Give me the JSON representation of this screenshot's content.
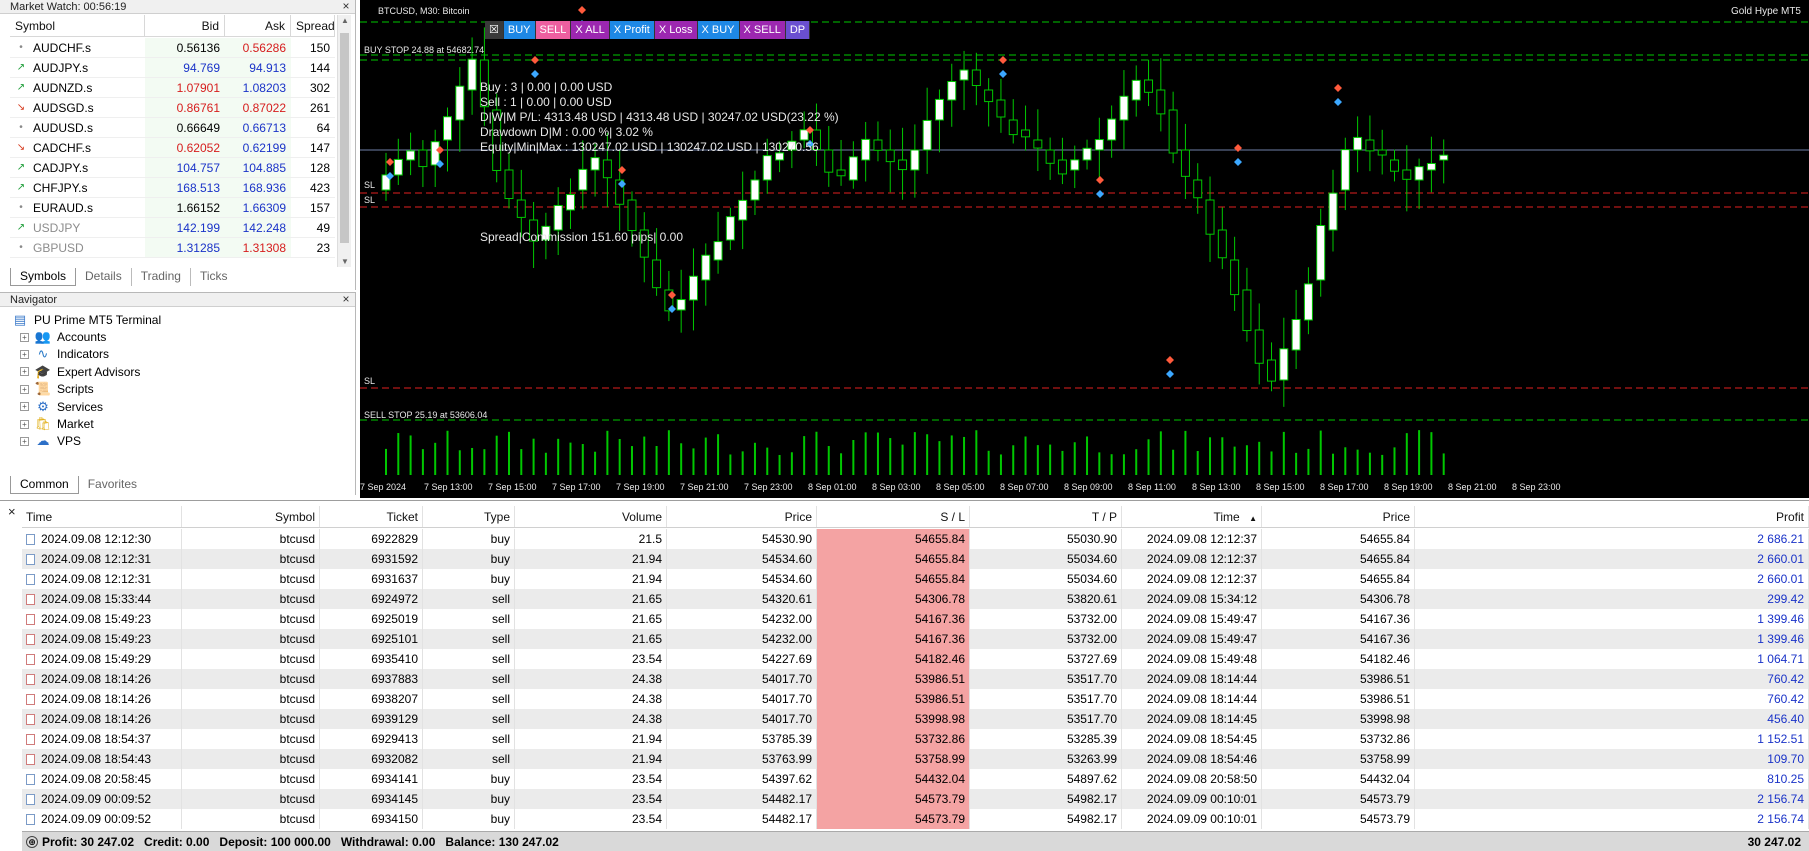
{
  "market_watch": {
    "title": "Market Watch: 00:56:19",
    "columns": [
      "Symbol",
      "Bid",
      "Ask",
      "Spread"
    ],
    "rows": [
      {
        "symbol": "AUDCHF.s",
        "bid": "0.56136",
        "ask": "0.56286",
        "spread": "150",
        "dir": "flat",
        "bid_color": "#000000",
        "ask_color": "#d61d1d"
      },
      {
        "symbol": "AUDJPY.s",
        "bid": "94.769",
        "ask": "94.913",
        "spread": "144",
        "dir": "up",
        "bid_color": "#1a33c8",
        "ask_color": "#1a33c8"
      },
      {
        "symbol": "AUDNZD.s",
        "bid": "1.07901",
        "ask": "1.08203",
        "spread": "302",
        "dir": "up",
        "bid_color": "#d61d1d",
        "ask_color": "#1a33c8"
      },
      {
        "symbol": "AUDSGD.s",
        "bid": "0.86761",
        "ask": "0.87022",
        "spread": "261",
        "dir": "down",
        "bid_color": "#d61d1d",
        "ask_color": "#d61d1d"
      },
      {
        "symbol": "AUDUSD.s",
        "bid": "0.66649",
        "ask": "0.66713",
        "spread": "64",
        "dir": "flat",
        "bid_color": "#000000",
        "ask_color": "#1a33c8"
      },
      {
        "symbol": "CADCHF.s",
        "bid": "0.62052",
        "ask": "0.62199",
        "spread": "147",
        "dir": "down",
        "bid_color": "#d61d1d",
        "ask_color": "#1a33c8"
      },
      {
        "symbol": "CADJPY.s",
        "bid": "104.757",
        "ask": "104.885",
        "spread": "128",
        "dir": "up",
        "bid_color": "#1a33c8",
        "ask_color": "#1a33c8"
      },
      {
        "symbol": "CHFJPY.s",
        "bid": "168.513",
        "ask": "168.936",
        "spread": "423",
        "dir": "up",
        "bid_color": "#1a33c8",
        "ask_color": "#1a33c8"
      },
      {
        "symbol": "EURAUD.s",
        "bid": "1.66152",
        "ask": "1.66309",
        "spread": "157",
        "dir": "flat",
        "bid_color": "#000000",
        "ask_color": "#1a33c8"
      },
      {
        "symbol": "USDJPY",
        "bid": "142.199",
        "ask": "142.248",
        "spread": "49",
        "dir": "up",
        "bid_color": "#1a33c8",
        "ask_color": "#1a33c8",
        "muted": true
      },
      {
        "symbol": "GBPUSD",
        "bid": "1.31285",
        "ask": "1.31308",
        "spread": "23",
        "dir": "flat",
        "bid_color": "#1a33c8",
        "ask_color": "#d61d1d",
        "muted": true
      }
    ],
    "tabs": [
      "Symbols",
      "Details",
      "Trading",
      "Ticks"
    ]
  },
  "navigator": {
    "title": "Navigator",
    "root": "PU Prime MT5 Terminal",
    "items": [
      {
        "label": "Accounts",
        "icon": "accounts-icon",
        "glyph": "👥",
        "color": "#2c6fc7"
      },
      {
        "label": "Indicators",
        "icon": "indicators-icon",
        "glyph": "∿",
        "color": "#2a7ac7"
      },
      {
        "label": "Expert Advisors",
        "icon": "expert-advisors-icon",
        "glyph": "🎓",
        "color": "#2c6fc7"
      },
      {
        "label": "Scripts",
        "icon": "scripts-icon",
        "glyph": "📜",
        "color": "#d8a52a"
      },
      {
        "label": "Services",
        "icon": "services-icon",
        "glyph": "⚙",
        "color": "#2c6fc7"
      },
      {
        "label": "Market",
        "icon": "market-icon",
        "glyph": "🛍",
        "color": "#e2b21f"
      },
      {
        "label": "VPS",
        "icon": "vps-icon",
        "glyph": "☁",
        "color": "#2c6fc7"
      }
    ],
    "tabs": [
      "Common",
      "Favorites"
    ]
  },
  "chart": {
    "symbol_title": "BTCUSD, M30: Bitcoin",
    "ea_name": "Gold Hype MT5",
    "toolbar": [
      {
        "label": "☒",
        "color": "#3a3a3a"
      },
      {
        "label": "BUY",
        "color": "#1e88e5"
      },
      {
        "label": "SELL",
        "color": "#ee5fa0"
      },
      {
        "label": "X ALL",
        "color": "#9c27b0"
      },
      {
        "label": "X Profit",
        "color": "#1e88e5"
      },
      {
        "label": "X Loss",
        "color": "#9c27b0"
      },
      {
        "label": "X BUY",
        "color": "#1e88e5"
      },
      {
        "label": "X SELL",
        "color": "#9c27b0"
      },
      {
        "label": "DP",
        "color": "#6a4fd0"
      }
    ],
    "buy_stop_label": "BUY STOP 24.88 at 54682.74",
    "sell_stop_label": "SELL STOP 25.19 at 53606.04",
    "sl_label": "SL",
    "info_lines": [
      "Buy : 3 | 0.00 | 0.00 USD",
      "Sell : 1 | 0.00 | 0.00 USD",
      "D|W|M P/L: 4313.48 USD | 4313.48 USD | 30247.02 USD(23.22 %)",
      "Drawdown D|M : 0.00 %| 3.02 %",
      "Equity|Min|Max : 130247.02 USD | 130247.02 USD | 130270.56"
    ],
    "spread_line": "Spread|Commission 151.60 pips| 0.00",
    "x_labels": [
      "7 Sep 2024",
      "7 Sep 13:00",
      "7 Sep 15:00",
      "7 Sep 17:00",
      "7 Sep 19:00",
      "7 Sep 21:00",
      "7 Sep 23:00",
      "8 Sep 01:00",
      "8 Sep 03:00",
      "8 Sep 05:00",
      "8 Sep 07:00",
      "8 Sep 09:00",
      "8 Sep 11:00",
      "8 Sep 13:00",
      "8 Sep 15:00",
      "8 Sep 17:00",
      "8 Sep 19:00",
      "8 Sep 21:00",
      "8 Sep 23:00"
    ],
    "colors": {
      "background": "#000000",
      "bull": "#ffffff",
      "bear": "#000000",
      "wick": "#00c800",
      "buy_line": "#00c800",
      "sell_line": "#e02020",
      "volume": "#00c800"
    }
  },
  "positions": {
    "columns": [
      "Time",
      "Symbol",
      "Ticket",
      "Type",
      "Volume",
      "Price",
      "S / L",
      "T / P",
      "Time",
      "Price",
      "Profit"
    ],
    "sort_indicator": "▲",
    "rows": [
      [
        "2024.09.08 12:12:30",
        "btcusd",
        "6922829",
        "buy",
        "21.5",
        "54530.90",
        "54655.84",
        "55030.90",
        "2024.09.08 12:12:37",
        "54655.84",
        "2 686.21"
      ],
      [
        "2024.09.08 12:12:31",
        "btcusd",
        "6931592",
        "buy",
        "21.94",
        "54534.60",
        "54655.84",
        "55034.60",
        "2024.09.08 12:12:37",
        "54655.84",
        "2 660.01"
      ],
      [
        "2024.09.08 12:12:31",
        "btcusd",
        "6931637",
        "buy",
        "21.94",
        "54534.60",
        "54655.84",
        "55034.60",
        "2024.09.08 12:12:37",
        "54655.84",
        "2 660.01"
      ],
      [
        "2024.09.08 15:33:44",
        "btcusd",
        "6924972",
        "sell",
        "21.65",
        "54320.61",
        "54306.78",
        "53820.61",
        "2024.09.08 15:34:12",
        "54306.78",
        "299.42"
      ],
      [
        "2024.09.08 15:49:23",
        "btcusd",
        "6925019",
        "sell",
        "21.65",
        "54232.00",
        "54167.36",
        "53732.00",
        "2024.09.08 15:49:47",
        "54167.36",
        "1 399.46"
      ],
      [
        "2024.09.08 15:49:23",
        "btcusd",
        "6925101",
        "sell",
        "21.65",
        "54232.00",
        "54167.36",
        "53732.00",
        "2024.09.08 15:49:47",
        "54167.36",
        "1 399.46"
      ],
      [
        "2024.09.08 15:49:29",
        "btcusd",
        "6935410",
        "sell",
        "23.54",
        "54227.69",
        "54182.46",
        "53727.69",
        "2024.09.08 15:49:48",
        "54182.46",
        "1 064.71"
      ],
      [
        "2024.09.08 18:14:26",
        "btcusd",
        "6937883",
        "sell",
        "24.38",
        "54017.70",
        "53986.51",
        "53517.70",
        "2024.09.08 18:14:44",
        "53986.51",
        "760.42"
      ],
      [
        "2024.09.08 18:14:26",
        "btcusd",
        "6938207",
        "sell",
        "24.38",
        "54017.70",
        "53986.51",
        "53517.70",
        "2024.09.08 18:14:44",
        "53986.51",
        "760.42"
      ],
      [
        "2024.09.08 18:14:26",
        "btcusd",
        "6939129",
        "sell",
        "24.38",
        "54017.70",
        "53998.98",
        "53517.70",
        "2024.09.08 18:14:45",
        "53998.98",
        "456.40"
      ],
      [
        "2024.09.08 18:54:37",
        "btcusd",
        "6929413",
        "sell",
        "21.94",
        "53785.39",
        "53732.86",
        "53285.39",
        "2024.09.08 18:54:45",
        "53732.86",
        "1 152.51"
      ],
      [
        "2024.09.08 18:54:43",
        "btcusd",
        "6932082",
        "sell",
        "21.94",
        "53763.99",
        "53758.99",
        "53263.99",
        "2024.09.08 18:54:46",
        "53758.99",
        "109.70"
      ],
      [
        "2024.09.08 20:58:45",
        "btcusd",
        "6934141",
        "buy",
        "23.54",
        "54397.62",
        "54432.04",
        "54897.62",
        "2024.09.08 20:58:50",
        "54432.04",
        "810.25"
      ],
      [
        "2024.09.09 00:09:52",
        "btcusd",
        "6934145",
        "buy",
        "23.54",
        "54482.17",
        "54573.79",
        "54982.17",
        "2024.09.09 00:10:01",
        "54573.79",
        "2 156.74"
      ],
      [
        "2024.09.09 00:09:52",
        "btcusd",
        "6934150",
        "buy",
        "23.54",
        "54482.17",
        "54573.79",
        "54982.17",
        "2024.09.09 00:10:01",
        "54573.79",
        "2 156.74"
      ]
    ],
    "footer": {
      "profit": "Profit: 30 247.02",
      "credit": "Credit: 0.00",
      "deposit": "Deposit: 100 000.00",
      "withdrawal": "Withdrawal: 0.00",
      "balance": "Balance: 130 247.02",
      "total": "30 247.02"
    }
  }
}
